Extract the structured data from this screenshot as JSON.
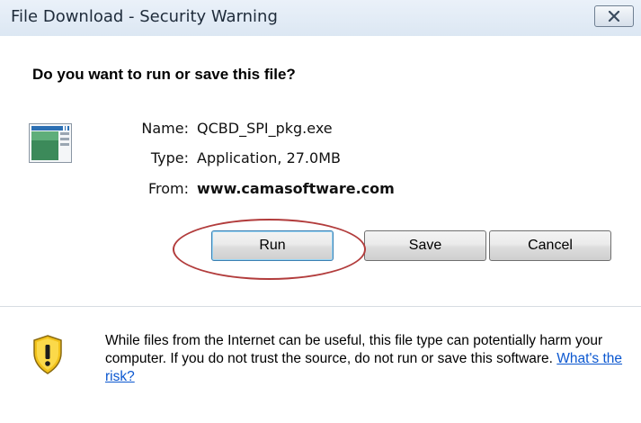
{
  "window": {
    "title": "File Download - Security Warning"
  },
  "dialog": {
    "question": "Do you want to run or save this file?",
    "file": {
      "name_label": "Name:",
      "name_value": "QCBD_SPI_pkg.exe",
      "type_label": "Type:",
      "type_value": "Application, 27.0MB",
      "from_label": "From:",
      "from_value": "www.camasoftware.com"
    },
    "buttons": {
      "run": "Run",
      "save": "Save",
      "cancel": "Cancel"
    },
    "warning": {
      "text": "While files from the Internet can be useful, this file type can potentially harm your computer. If you do not trust the source, do not run or save this software. ",
      "link": "What's the risk?"
    }
  },
  "colors": {
    "title_bar": "#dce7f3",
    "highlight_circle": "#b23c3c",
    "link": "#0b57d0",
    "shield_yellow": "#f2c21a"
  },
  "icons": [
    "close-icon",
    "application-file-icon",
    "warning-shield-icon"
  ]
}
